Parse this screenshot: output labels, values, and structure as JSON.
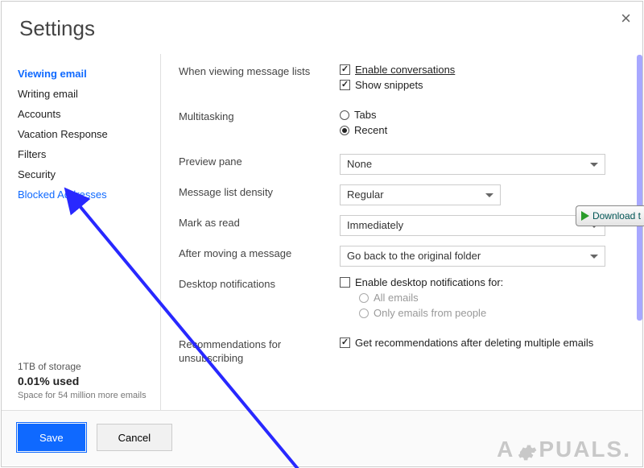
{
  "title": "Settings",
  "sidebar": {
    "items": [
      {
        "label": "Viewing email",
        "active": true
      },
      {
        "label": "Writing email"
      },
      {
        "label": "Accounts"
      },
      {
        "label": "Vacation Response"
      },
      {
        "label": "Filters"
      },
      {
        "label": "Security"
      },
      {
        "label": "Blocked Addresses",
        "highlight": true
      }
    ],
    "storage": {
      "line1": "1TB of storage",
      "line2": "0.01% used",
      "line3": "Space for 54 million more emails"
    }
  },
  "settings": {
    "viewing_lists": {
      "label": "When viewing message lists",
      "enable_conversations": {
        "label": "Enable conversations",
        "checked": true
      },
      "show_snippets": {
        "label": "Show snippets",
        "checked": true
      }
    },
    "multitasking": {
      "label": "Multitasking",
      "tabs": {
        "label": "Tabs",
        "checked": false
      },
      "recent": {
        "label": "Recent",
        "checked": true
      }
    },
    "preview_pane": {
      "label": "Preview pane",
      "value": "None"
    },
    "density": {
      "label": "Message list density",
      "value": "Regular"
    },
    "mark_read": {
      "label": "Mark as read",
      "value": "Immediately"
    },
    "after_move": {
      "label": "After moving a message",
      "value": "Go back to the original folder"
    },
    "desktop_notifications": {
      "label": "Desktop notifications",
      "enable": {
        "label": "Enable desktop notifications for:",
        "checked": false
      },
      "all": {
        "label": "All emails"
      },
      "people": {
        "label": "Only emails from people"
      }
    },
    "recommendations": {
      "label": "Recommendations for unsubscribing",
      "reco": {
        "label": "Get recommendations after deleting multiple emails",
        "checked": true
      }
    }
  },
  "footer": {
    "save": "Save",
    "cancel": "Cancel"
  },
  "overlay": {
    "download": "Download t",
    "watermark_a": "A",
    "watermark_puals": "PUALS."
  }
}
